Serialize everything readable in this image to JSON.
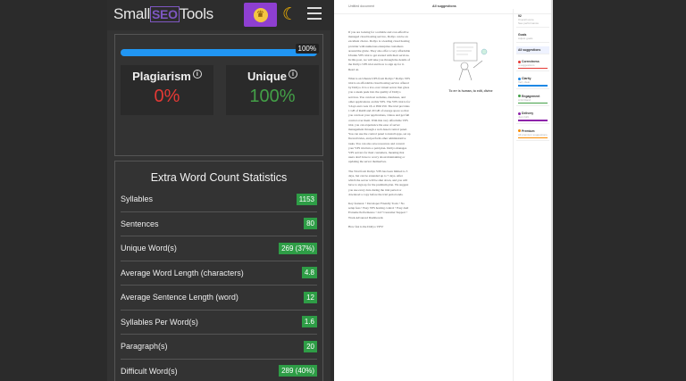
{
  "header": {
    "logo_prefix": "Small",
    "logo_mid": "SEO",
    "logo_suffix": "Tools",
    "crown_icon": "crown-icon",
    "theme_icon": "moon-icon",
    "menu_icon": "hamburger-icon"
  },
  "result": {
    "progress_percent": 100,
    "progress_label": "100%",
    "plagiarism_title": "Plagiarism",
    "plagiarism_value": "0%",
    "unique_title": "Unique",
    "unique_value": "100%",
    "colors": {
      "progress": "#2196f3",
      "plagiarism": "#e53935",
      "unique": "#43a047"
    }
  },
  "stats": {
    "title": "Extra Word Count Statistics",
    "rows": [
      {
        "label": "Syllables",
        "value": "1153"
      },
      {
        "label": "Sentences",
        "value": "80"
      },
      {
        "label": "Unique Word(s)",
        "value": "269 (37%)"
      },
      {
        "label": "Average Word Length (characters)",
        "value": "4.8"
      },
      {
        "label": "Average Sentence Length (word)",
        "value": "12"
      },
      {
        "label": "Syllables Per Word(s)",
        "value": "1.6"
      },
      {
        "label": "Paragraph(s)",
        "value": "20"
      },
      {
        "label": "Difficult Word(s)",
        "value": "289 (40%)"
      }
    ]
  },
  "document": {
    "top_left": "Untitled document",
    "top_center": "All suggestions",
    "caption": "To err is human, to edit, divine",
    "paragraphs": [
      "If you are looking for a reliable and cost-effective managed cloud hosting service, Dollyo can be an excellent choice. Dollyo is a leading cloud hosting provider with numerous enterprise customers around the globe. They also offer a very affordable Ubuntu VPS trial to get started with their services. In this post, we will take you through the details of the Dollyo VPS trial and how to sign up for it. Read on.",
      "What is an Ubuntu VPS from Dollyo? Dollyo VPS trial is an affordable cloud hosting service offered by Dollyo. It is a low-cost virtual server that gives you a sneak peek into the quality of Dollyo services. You can host websites, databases, and other applications on this VPS. The VPS trial is for 3 days and costs 1$ or INR 250. The trial provides 1 GB of RAM and 20 GB of storage space so that you can host your applications, videos and get full control over them. With this very affordable VPS trial, you can experience the ease of server management through a web-based control panel. You can use the control panel to install apps, set up firewall rules, and perform other administrative tasks. You can also save resources and convert your VPS trial into a paid plan. Dollyo manages VPS servers for their customers, meaning that users don't have to worry about maintaining or updating the server themselves.",
      "The Trial from Dollyo VPS has been limited to 3 days, but can be extended up to 7 days. After which the server will be shut down, and you will have to sign up for the premium plan. We suggest you use every data during the trial period or download a copy before the trial period ends.",
      "Key features: • Developer Friendly Tools • No setup fees • Easy VPS hosting control • Easy And Extreme Performance • 24/7 Customer Support • Work Advanced Dashboards",
      "How fast is the Dollyo VPS?"
    ]
  },
  "sidebar": {
    "blocks": [
      {
        "title": "92",
        "sub": "Overall score",
        "note": "See performance"
      },
      {
        "title": "Goals",
        "sub": "Adjust goals"
      },
      {
        "title": "All suggestions",
        "sub": ""
      },
      {
        "title": "Correctness",
        "sub": "4 suggestions",
        "color": "#e53935"
      },
      {
        "title": "Clarity",
        "sub": "Very clear",
        "color": "#1e88e5"
      },
      {
        "title": "Engagement",
        "sub": "A bit bland",
        "color": "#43a047"
      },
      {
        "title": "Delivery",
        "sub": "Just right",
        "color": "#8e24aa"
      },
      {
        "title": "Premium",
        "sub": "All premium suggestions",
        "color": "#fb8c00"
      }
    ]
  }
}
